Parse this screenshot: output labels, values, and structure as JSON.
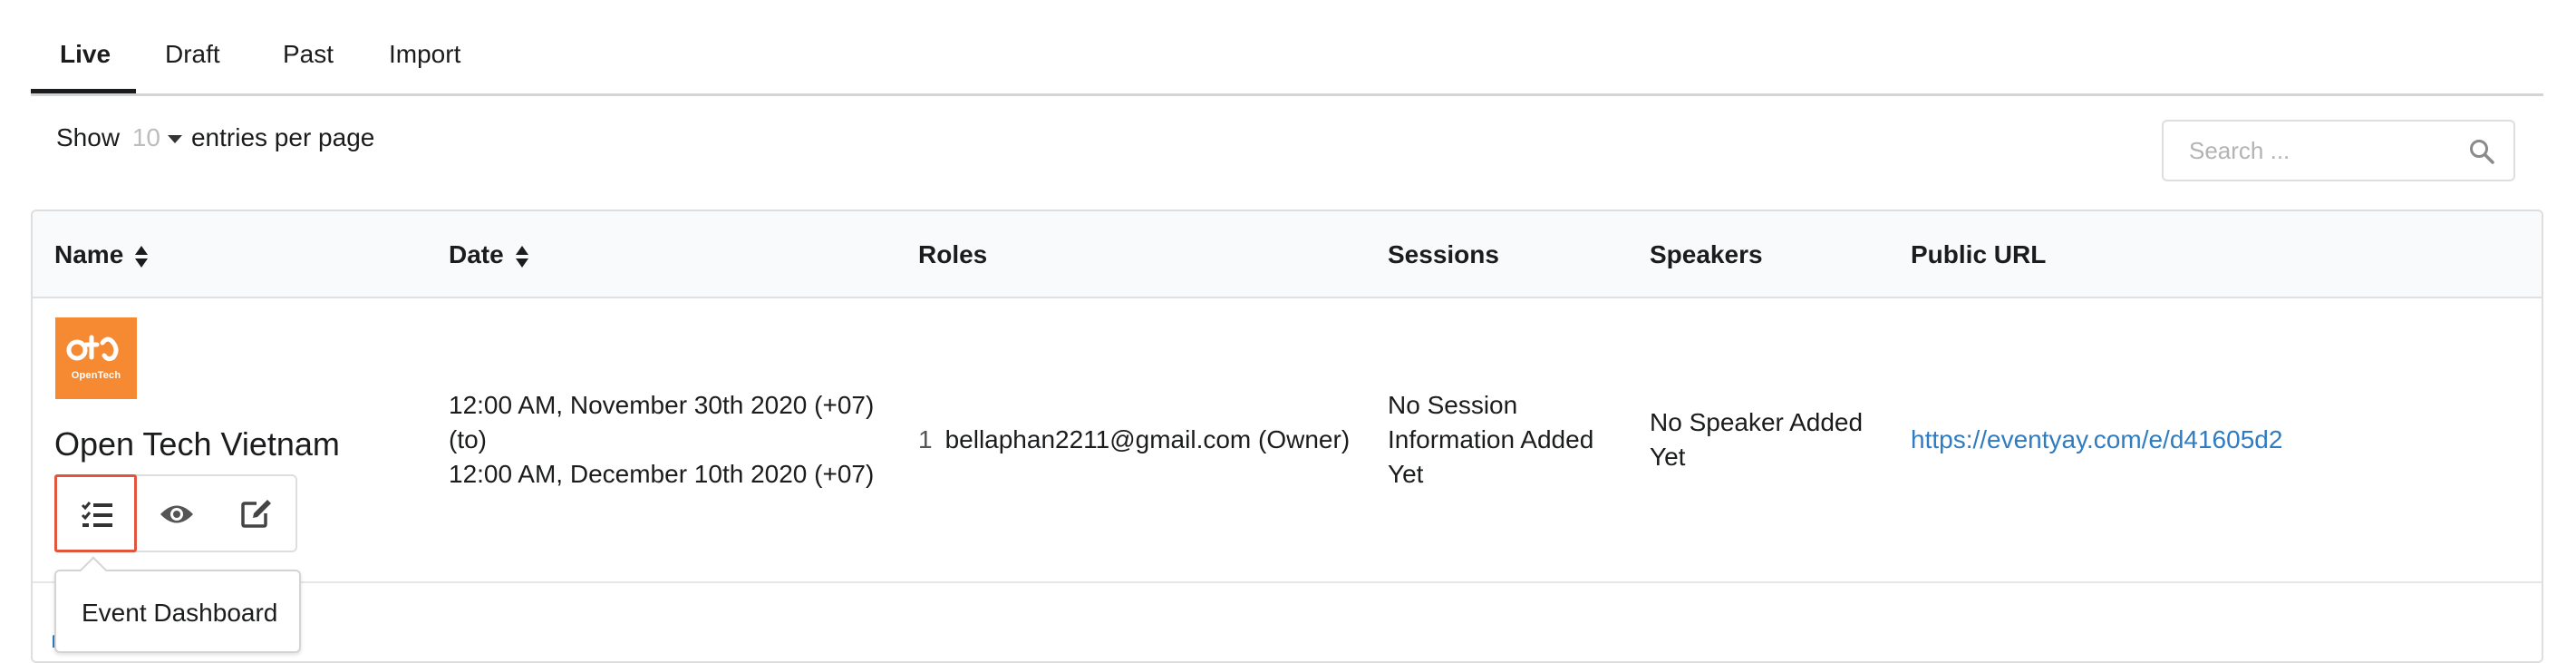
{
  "tabs": [
    {
      "label": "Live",
      "active": true
    },
    {
      "label": "Draft",
      "active": false
    },
    {
      "label": "Past",
      "active": false
    },
    {
      "label": "Import",
      "active": false
    }
  ],
  "entries": {
    "prefix": "Show",
    "value": "10",
    "suffix": "entries per page"
  },
  "search": {
    "placeholder": "Search ...",
    "value": ""
  },
  "table": {
    "headers": {
      "name": "Name",
      "date": "Date",
      "roles": "Roles",
      "sessions": "Sessions",
      "speakers": "Speakers",
      "public_url": "Public URL"
    },
    "rows": [
      {
        "logo_text": "OpenTech",
        "name": "Open Tech Vietnam",
        "date_start": "12:00 AM, November 30th 2020 (+07)",
        "date_to": "(to)",
        "date_end": "12:00 AM, December 10th 2020 (+07)",
        "role_index": "1",
        "role": "bellaphan2211@gmail.com (Owner)",
        "sessions": "No Session Information Added Yet",
        "speakers": "No Speaker Added Yet",
        "public_url": "https://eventyay.com/e/d41605d2"
      }
    ]
  },
  "tooltip": {
    "text": "Event Dashboard"
  },
  "colors": {
    "accent_link": "#2f7cc1",
    "logo_bg": "#f58a33",
    "highlight_border": "#e0553e"
  },
  "icons": {
    "search": "search-icon",
    "sort": "sort-icon",
    "dashboard": "tasks-icon",
    "view": "eye-icon",
    "edit": "edit-icon"
  }
}
